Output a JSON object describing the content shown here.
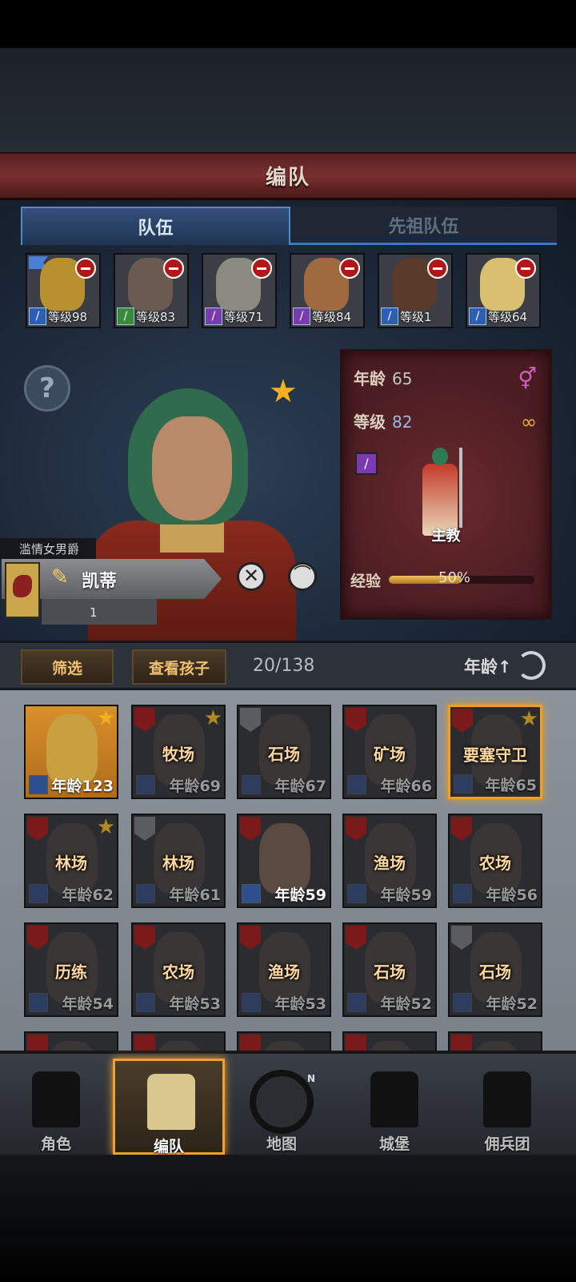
{
  "header": {
    "title": "编队"
  },
  "tabs": [
    {
      "label": "队伍",
      "active": true
    },
    {
      "label": "先祖队伍",
      "active": false
    }
  ],
  "team": [
    {
      "level": "等级98",
      "cls_color": "#2e5db8",
      "face": "#b89030",
      "flag": true
    },
    {
      "level": "等级83",
      "cls_color": "#3a8a3a",
      "face": "#6a5a50",
      "flag": false
    },
    {
      "level": "等级71",
      "cls_color": "#7b3ab0",
      "face": "#8a8a80",
      "flag": false
    },
    {
      "level": "等级84",
      "cls_color": "#7b3ab0",
      "face": "#a06a40",
      "flag": false
    },
    {
      "level": "等级1",
      "cls_color": "#2e5db8",
      "face": "#5a3a2a",
      "flag": false
    },
    {
      "level": "等级64",
      "cls_color": "#2e5db8",
      "face": "#d8c070",
      "flag": false
    }
  ],
  "character": {
    "title": "滥情女男爵",
    "name": "凯蒂",
    "sub_value": "1",
    "age_label": "年龄",
    "age": "65",
    "level_label": "等级",
    "level": "82",
    "class_name": "主教",
    "exp_label": "经验",
    "exp_percent": "50%",
    "exp_fraction": 0.5
  },
  "icons": {
    "help": "?",
    "close": "✕",
    "hat": "⌒",
    "star": "★",
    "gender": "⚥",
    "ring": "∞",
    "edit": "✎"
  },
  "filter_bar": {
    "filter_label": "筛选",
    "children_label": "查看孩子",
    "count": "20/138",
    "sort_label": "年龄↑"
  },
  "grid": [
    {
      "job": "",
      "age": "年龄123",
      "gold": true,
      "bright": true,
      "shield": "none",
      "star": true,
      "selected": false
    },
    {
      "job": "牧场",
      "age": "年龄69",
      "shield": "red",
      "star": true
    },
    {
      "job": "石场",
      "age": "年龄67",
      "shield": "gray",
      "star": false
    },
    {
      "job": "矿场",
      "age": "年龄66",
      "shield": "red",
      "star": false
    },
    {
      "job": "要塞守卫",
      "age": "年龄65",
      "shield": "red",
      "star": true,
      "selected": true
    },
    {
      "job": "林场",
      "age": "年龄62",
      "shield": "red",
      "star": true
    },
    {
      "job": "林场",
      "age": "年龄61",
      "shield": "gray",
      "star": false
    },
    {
      "job": "",
      "age": "年龄59",
      "shield": "red",
      "star": false,
      "bright": true
    },
    {
      "job": "渔场",
      "age": "年龄59",
      "shield": "red",
      "star": false
    },
    {
      "job": "农场",
      "age": "年龄56",
      "shield": "red",
      "star": false
    },
    {
      "job": "历练",
      "age": "年龄54",
      "shield": "red",
      "star": false
    },
    {
      "job": "农场",
      "age": "年龄53",
      "shield": "red",
      "star": false
    },
    {
      "job": "渔场",
      "age": "年龄53",
      "shield": "red",
      "star": false
    },
    {
      "job": "石场",
      "age": "年龄52",
      "shield": "red",
      "star": false
    },
    {
      "job": "石场",
      "age": "年龄52",
      "shield": "gray",
      "star": false
    }
  ],
  "nav": [
    {
      "label": "角色",
      "active": false
    },
    {
      "label": "编队",
      "active": true
    },
    {
      "label": "地图",
      "active": false
    },
    {
      "label": "城堡",
      "active": false
    },
    {
      "label": "佣兵团",
      "active": false
    }
  ]
}
